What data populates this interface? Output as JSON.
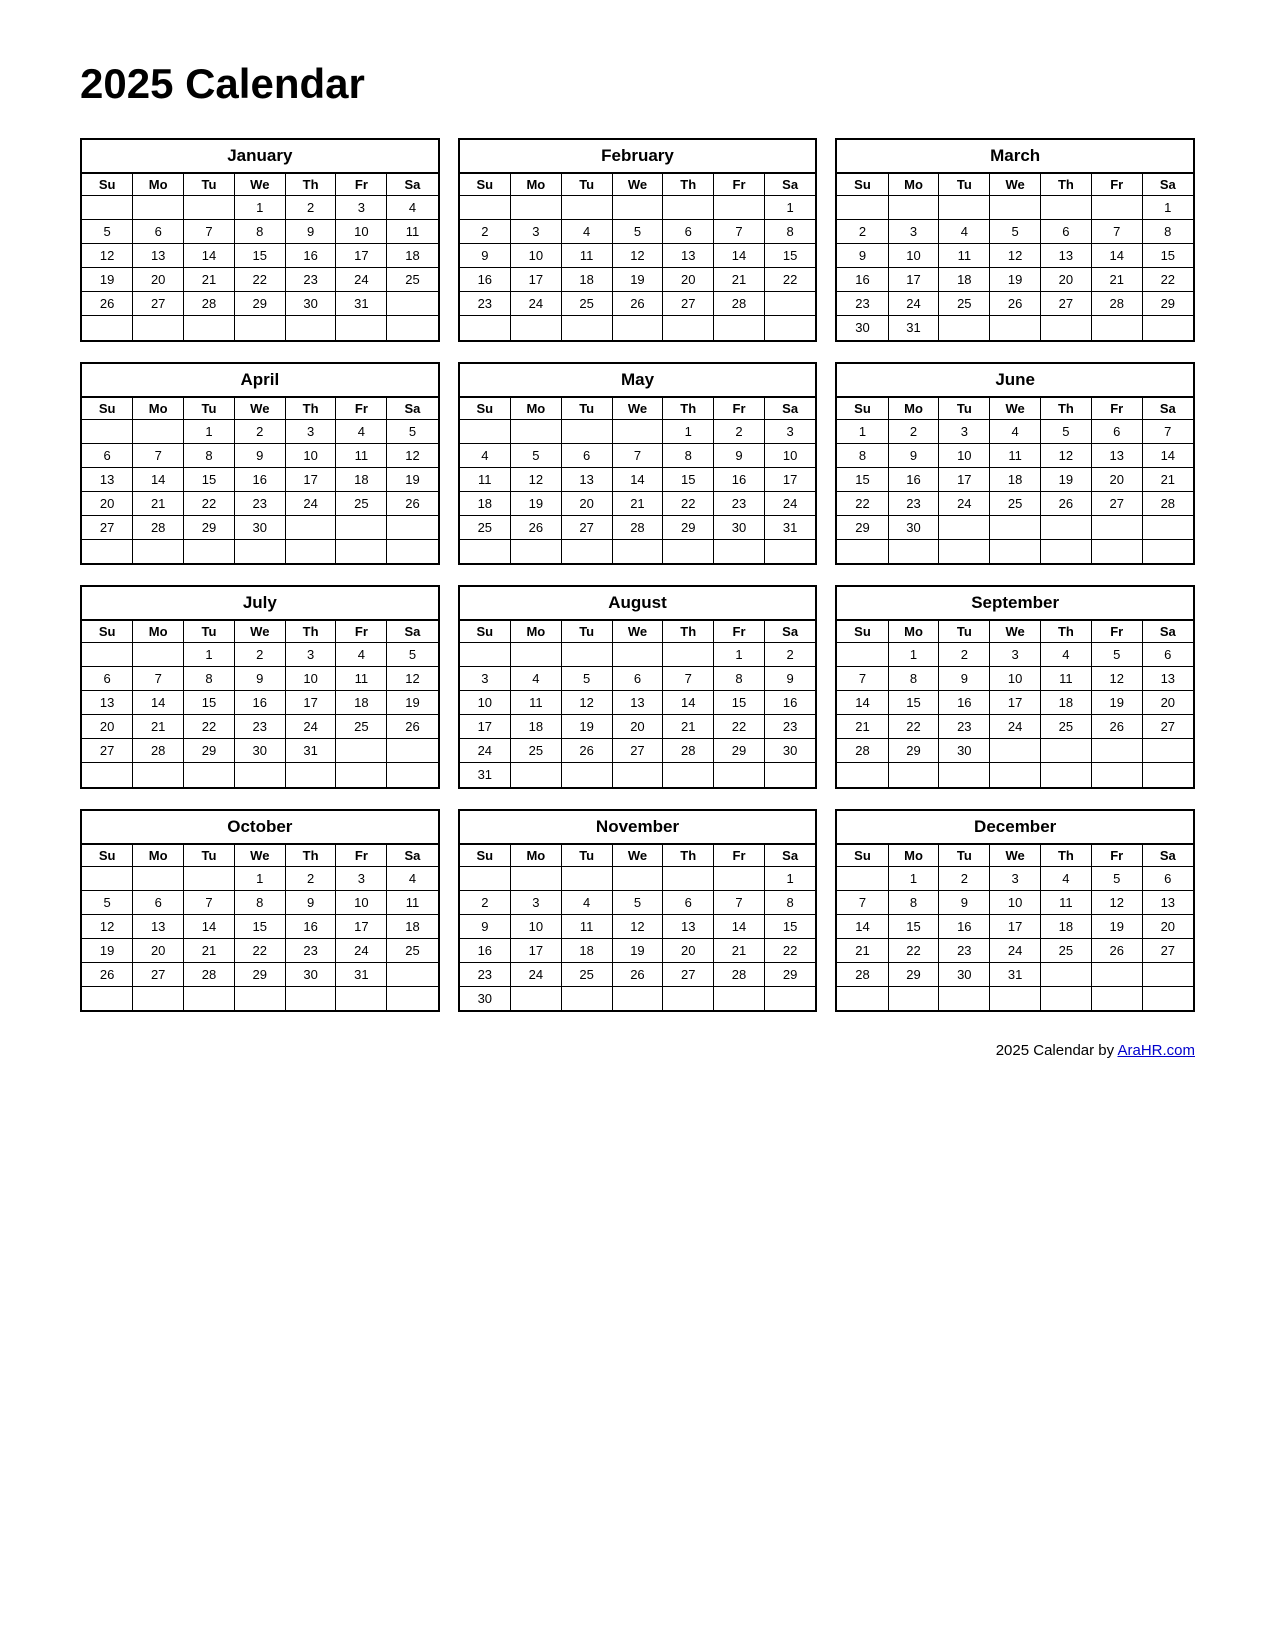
{
  "title": "2025 Calendar",
  "footer": {
    "text": "2025  Calendar by ",
    "link_text": "AraHR.com",
    "link_url": "AraHR.com"
  },
  "months": [
    {
      "name": "January",
      "days_header": [
        "Su",
        "Mo",
        "Tu",
        "We",
        "Th",
        "Fr",
        "Sa"
      ],
      "weeks": [
        [
          "",
          "",
          "",
          "1",
          "2",
          "3",
          "4"
        ],
        [
          "5",
          "6",
          "7",
          "8",
          "9",
          "10",
          "11"
        ],
        [
          "12",
          "13",
          "14",
          "15",
          "16",
          "17",
          "18"
        ],
        [
          "19",
          "20",
          "21",
          "22",
          "23",
          "24",
          "25"
        ],
        [
          "26",
          "27",
          "28",
          "29",
          "30",
          "31",
          ""
        ],
        [
          "",
          "",
          "",
          "",
          "",
          "",
          ""
        ]
      ]
    },
    {
      "name": "February",
      "days_header": [
        "Su",
        "Mo",
        "Tu",
        "We",
        "Th",
        "Fr",
        "Sa"
      ],
      "weeks": [
        [
          "",
          "",
          "",
          "",
          "",
          "",
          "1"
        ],
        [
          "2",
          "3",
          "4",
          "5",
          "6",
          "7",
          "8"
        ],
        [
          "9",
          "10",
          "11",
          "12",
          "13",
          "14",
          "15"
        ],
        [
          "16",
          "17",
          "18",
          "19",
          "20",
          "21",
          "22"
        ],
        [
          "23",
          "24",
          "25",
          "26",
          "27",
          "28",
          ""
        ],
        [
          "",
          "",
          "",
          "",
          "",
          "",
          ""
        ]
      ]
    },
    {
      "name": "March",
      "days_header": [
        "Su",
        "Mo",
        "Tu",
        "We",
        "Th",
        "Fr",
        "Sa"
      ],
      "weeks": [
        [
          "",
          "",
          "",
          "",
          "",
          "",
          "1"
        ],
        [
          "2",
          "3",
          "4",
          "5",
          "6",
          "7",
          "8"
        ],
        [
          "9",
          "10",
          "11",
          "12",
          "13",
          "14",
          "15"
        ],
        [
          "16",
          "17",
          "18",
          "19",
          "20",
          "21",
          "22"
        ],
        [
          "23",
          "24",
          "25",
          "26",
          "27",
          "28",
          "29"
        ],
        [
          "30",
          "31",
          "",
          "",
          "",
          "",
          ""
        ]
      ]
    },
    {
      "name": "April",
      "days_header": [
        "Su",
        "Mo",
        "Tu",
        "We",
        "Th",
        "Fr",
        "Sa"
      ],
      "weeks": [
        [
          "",
          "",
          "1",
          "2",
          "3",
          "4",
          "5"
        ],
        [
          "6",
          "7",
          "8",
          "9",
          "10",
          "11",
          "12"
        ],
        [
          "13",
          "14",
          "15",
          "16",
          "17",
          "18",
          "19"
        ],
        [
          "20",
          "21",
          "22",
          "23",
          "24",
          "25",
          "26"
        ],
        [
          "27",
          "28",
          "29",
          "30",
          "",
          "",
          ""
        ],
        [
          "",
          "",
          "",
          "",
          "",
          "",
          ""
        ]
      ]
    },
    {
      "name": "May",
      "days_header": [
        "Su",
        "Mo",
        "Tu",
        "We",
        "Th",
        "Fr",
        "Sa"
      ],
      "weeks": [
        [
          "",
          "",
          "",
          "",
          "1",
          "2",
          "3"
        ],
        [
          "4",
          "5",
          "6",
          "7",
          "8",
          "9",
          "10"
        ],
        [
          "11",
          "12",
          "13",
          "14",
          "15",
          "16",
          "17"
        ],
        [
          "18",
          "19",
          "20",
          "21",
          "22",
          "23",
          "24"
        ],
        [
          "25",
          "26",
          "27",
          "28",
          "29",
          "30",
          "31"
        ],
        [
          "",
          "",
          "",
          "",
          "",
          "",
          ""
        ]
      ]
    },
    {
      "name": "June",
      "days_header": [
        "Su",
        "Mo",
        "Tu",
        "We",
        "Th",
        "Fr",
        "Sa"
      ],
      "weeks": [
        [
          "1",
          "2",
          "3",
          "4",
          "5",
          "6",
          "7"
        ],
        [
          "8",
          "9",
          "10",
          "11",
          "12",
          "13",
          "14"
        ],
        [
          "15",
          "16",
          "17",
          "18",
          "19",
          "20",
          "21"
        ],
        [
          "22",
          "23",
          "24",
          "25",
          "26",
          "27",
          "28"
        ],
        [
          "29",
          "30",
          "",
          "",
          "",
          "",
          ""
        ],
        [
          "",
          "",
          "",
          "",
          "",
          "",
          ""
        ]
      ]
    },
    {
      "name": "July",
      "days_header": [
        "Su",
        "Mo",
        "Tu",
        "We",
        "Th",
        "Fr",
        "Sa"
      ],
      "weeks": [
        [
          "",
          "",
          "1",
          "2",
          "3",
          "4",
          "5"
        ],
        [
          "6",
          "7",
          "8",
          "9",
          "10",
          "11",
          "12"
        ],
        [
          "13",
          "14",
          "15",
          "16",
          "17",
          "18",
          "19"
        ],
        [
          "20",
          "21",
          "22",
          "23",
          "24",
          "25",
          "26"
        ],
        [
          "27",
          "28",
          "29",
          "30",
          "31",
          "",
          ""
        ],
        [
          "",
          "",
          "",
          "",
          "",
          "",
          ""
        ]
      ]
    },
    {
      "name": "August",
      "days_header": [
        "Su",
        "Mo",
        "Tu",
        "We",
        "Th",
        "Fr",
        "Sa"
      ],
      "weeks": [
        [
          "",
          "",
          "",
          "",
          "",
          "1",
          "2"
        ],
        [
          "3",
          "4",
          "5",
          "6",
          "7",
          "8",
          "9"
        ],
        [
          "10",
          "11",
          "12",
          "13",
          "14",
          "15",
          "16"
        ],
        [
          "17",
          "18",
          "19",
          "20",
          "21",
          "22",
          "23"
        ],
        [
          "24",
          "25",
          "26",
          "27",
          "28",
          "29",
          "30"
        ],
        [
          "31",
          "",
          "",
          "",
          "",
          "",
          ""
        ]
      ]
    },
    {
      "name": "September",
      "days_header": [
        "Su",
        "Mo",
        "Tu",
        "We",
        "Th",
        "Fr",
        "Sa"
      ],
      "weeks": [
        [
          "",
          "1",
          "2",
          "3",
          "4",
          "5",
          "6"
        ],
        [
          "7",
          "8",
          "9",
          "10",
          "11",
          "12",
          "13"
        ],
        [
          "14",
          "15",
          "16",
          "17",
          "18",
          "19",
          "20"
        ],
        [
          "21",
          "22",
          "23",
          "24",
          "25",
          "26",
          "27"
        ],
        [
          "28",
          "29",
          "30",
          "",
          "",
          "",
          ""
        ],
        [
          "",
          "",
          "",
          "",
          "",
          "",
          ""
        ]
      ]
    },
    {
      "name": "October",
      "days_header": [
        "Su",
        "Mo",
        "Tu",
        "We",
        "Th",
        "Fr",
        "Sa"
      ],
      "weeks": [
        [
          "",
          "",
          "",
          "1",
          "2",
          "3",
          "4"
        ],
        [
          "5",
          "6",
          "7",
          "8",
          "9",
          "10",
          "11"
        ],
        [
          "12",
          "13",
          "14",
          "15",
          "16",
          "17",
          "18"
        ],
        [
          "19",
          "20",
          "21",
          "22",
          "23",
          "24",
          "25"
        ],
        [
          "26",
          "27",
          "28",
          "29",
          "30",
          "31",
          ""
        ],
        [
          "",
          "",
          "",
          "",
          "",
          "",
          ""
        ]
      ]
    },
    {
      "name": "November",
      "days_header": [
        "Su",
        "Mo",
        "Tu",
        "We",
        "Th",
        "Fr",
        "Sa"
      ],
      "weeks": [
        [
          "",
          "",
          "",
          "",
          "",
          "",
          "1"
        ],
        [
          "2",
          "3",
          "4",
          "5",
          "6",
          "7",
          "8"
        ],
        [
          "9",
          "10",
          "11",
          "12",
          "13",
          "14",
          "15"
        ],
        [
          "16",
          "17",
          "18",
          "19",
          "20",
          "21",
          "22"
        ],
        [
          "23",
          "24",
          "25",
          "26",
          "27",
          "28",
          "29"
        ],
        [
          "30",
          "",
          "",
          "",
          "",
          "",
          ""
        ]
      ]
    },
    {
      "name": "December",
      "days_header": [
        "Su",
        "Mo",
        "Tu",
        "We",
        "Th",
        "Fr",
        "Sa"
      ],
      "weeks": [
        [
          "",
          "1",
          "2",
          "3",
          "4",
          "5",
          "6"
        ],
        [
          "7",
          "8",
          "9",
          "10",
          "11",
          "12",
          "13"
        ],
        [
          "14",
          "15",
          "16",
          "17",
          "18",
          "19",
          "20"
        ],
        [
          "21",
          "22",
          "23",
          "24",
          "25",
          "26",
          "27"
        ],
        [
          "28",
          "29",
          "30",
          "31",
          "",
          "",
          ""
        ],
        [
          "",
          "",
          "",
          "",
          "",
          "",
          ""
        ]
      ]
    }
  ]
}
